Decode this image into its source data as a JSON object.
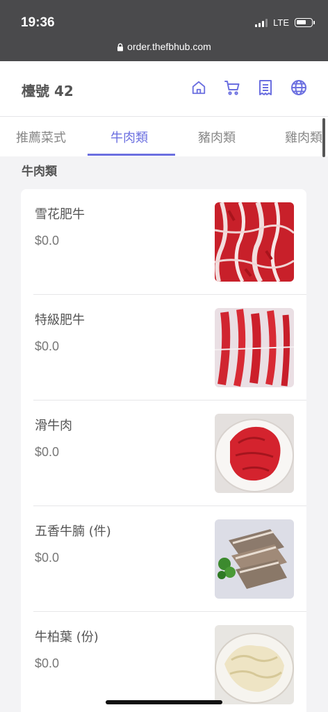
{
  "status": {
    "time": "19:36",
    "network": "LTE",
    "url": "order.thefbhub.com"
  },
  "header": {
    "table_label": "檯號 42",
    "icons": [
      "home-icon",
      "cart-icon",
      "receipt-icon",
      "globe-icon"
    ],
    "accent_color": "#6b6fe0"
  },
  "tabs": [
    {
      "label": "推薦菜式"
    },
    {
      "label": "牛肉類"
    },
    {
      "label": "豬肉類"
    },
    {
      "label": "雞肉類"
    }
  ],
  "section": {
    "title": "牛肉類"
  },
  "items": [
    {
      "name": "雪花肥牛",
      "price": "$0.0"
    },
    {
      "name": "特級肥牛",
      "price": "$0.0"
    },
    {
      "name": "滑牛肉",
      "price": "$0.0"
    },
    {
      "name": "五香牛腩 (件)",
      "price": "$0.0"
    },
    {
      "name": "牛柏葉 (份)",
      "price": "$0.0"
    }
  ]
}
